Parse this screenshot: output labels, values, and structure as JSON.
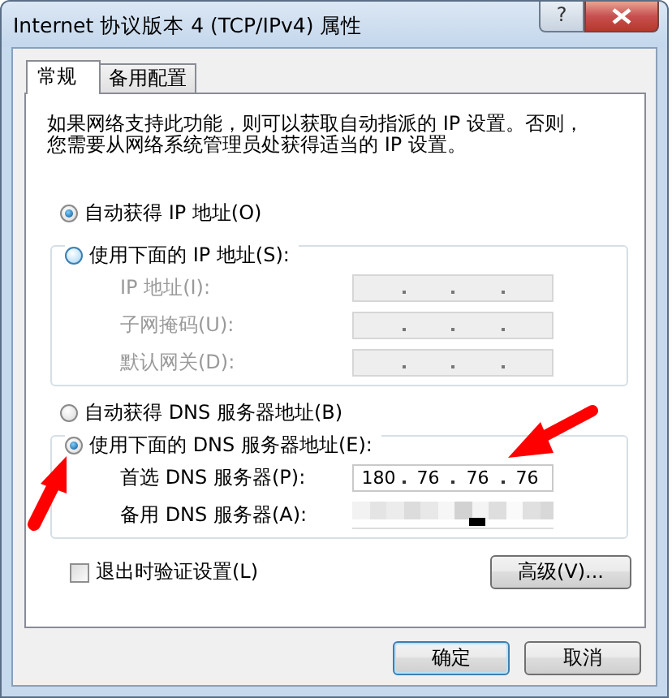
{
  "window": {
    "title": "Internet 协议版本 4 (TCP/IPv4) 属性",
    "help_label": "?"
  },
  "tabs": [
    {
      "label": "常规",
      "selected": true
    },
    {
      "label": "备用配置",
      "selected": false
    }
  ],
  "description": [
    "如果网络支持此功能，则可以获取自动指派的 IP 设置。否则，",
    "您需要从网络系统管理员处获得适当的 IP 设置。"
  ],
  "ip_options": [
    {
      "label": "自动获得 IP 地址(O)",
      "selected": true
    },
    {
      "label": "使用下面的 IP 地址(S):",
      "selected": false
    }
  ],
  "ip_fields": [
    {
      "label": "IP 地址(I):",
      "disabled": true
    },
    {
      "label": "子网掩码(U):",
      "disabled": true
    },
    {
      "label": "默认网关(D):",
      "disabled": true
    }
  ],
  "dns_options": [
    {
      "label": "自动获得 DNS 服务器地址(B)",
      "selected": false
    },
    {
      "label": "使用下面的 DNS 服务器地址(E):",
      "selected": true
    }
  ],
  "dns_fields": [
    {
      "label": "首选 DNS 服务器(P):",
      "disabled": false,
      "obscured": false,
      "octets": [
        "180",
        "76",
        "76",
        "76"
      ]
    },
    {
      "label": "备用 DNS 服务器(A):",
      "disabled": false,
      "obscured": true
    }
  ],
  "validate_checkbox": {
    "label": "退出时验证设置(L)",
    "checked": false
  },
  "advanced_button": "高级(V)...",
  "buttons": [
    {
      "label": "确定",
      "default": true
    },
    {
      "label": "取消",
      "default": false
    }
  ]
}
